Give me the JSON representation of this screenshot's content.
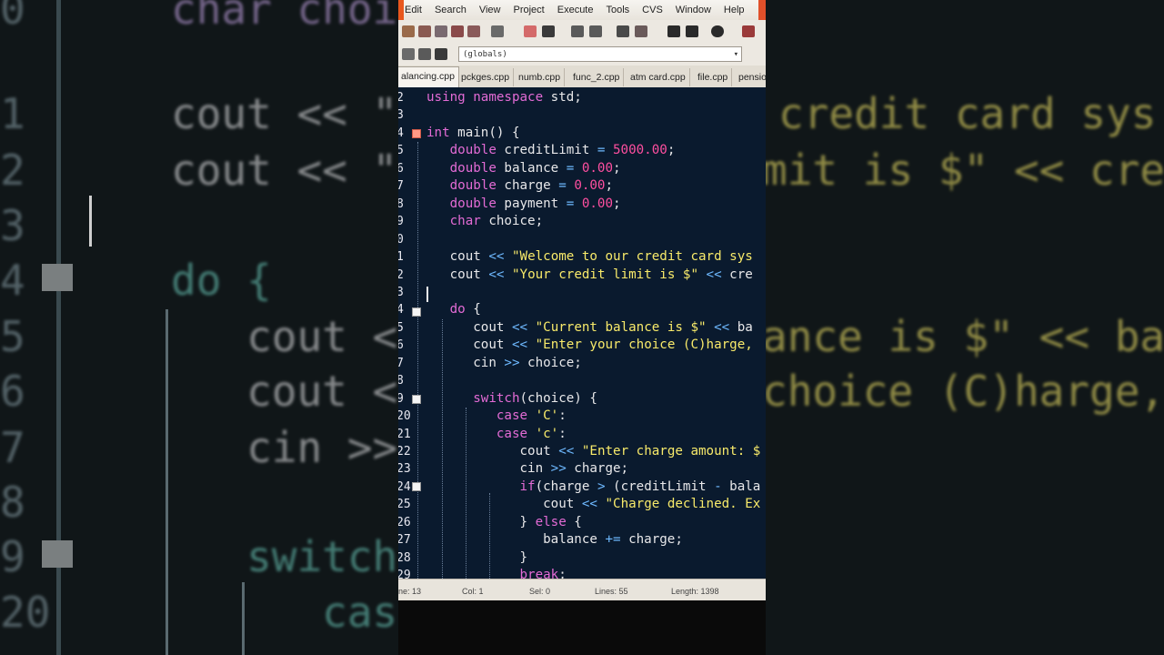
{
  "menu": [
    "Edit",
    "Search",
    "View",
    "Project",
    "Execute",
    "Tools",
    "CVS",
    "Window",
    "Help"
  ],
  "toolbar": {
    "scope_combo_value": "(globals)"
  },
  "tabs": [
    {
      "label": "alancing.cpp",
      "active": true
    },
    {
      "label": "pckges.cpp",
      "active": false
    },
    {
      "label": "numb.cpp",
      "active": false
    },
    {
      "label": "func_2.cpp",
      "active": false
    },
    {
      "label": "atm card.cpp",
      "active": false
    },
    {
      "label": "file.cpp",
      "active": false
    },
    {
      "label": "pensio",
      "active": false
    }
  ],
  "editor": {
    "lines": [
      {
        "n": "2",
        "text": "using namespace std;"
      },
      {
        "n": "3",
        "text": ""
      },
      {
        "n": "4",
        "text": "int main() {"
      },
      {
        "n": "5",
        "text": "   double creditLimit = 5000.00;"
      },
      {
        "n": "6",
        "text": "   double balance = 0.00;"
      },
      {
        "n": "7",
        "text": "   double charge = 0.00;"
      },
      {
        "n": "8",
        "text": "   double payment = 0.00;"
      },
      {
        "n": "9",
        "text": "   char choice;"
      },
      {
        "n": "0",
        "text": ""
      },
      {
        "n": "1",
        "text": "   cout << \"Welcome to our credit card sys"
      },
      {
        "n": "2",
        "text": "   cout << \"Your credit limit is $\" << cre"
      },
      {
        "n": "3",
        "text": ""
      },
      {
        "n": "4",
        "text": "   do {"
      },
      {
        "n": "5",
        "text": "      cout << \"Current balance is $\" << ba"
      },
      {
        "n": "6",
        "text": "      cout << \"Enter your choice (C)harge,"
      },
      {
        "n": "7",
        "text": "      cin >> choice;"
      },
      {
        "n": "8",
        "text": ""
      },
      {
        "n": "9",
        "text": "      switch(choice) {"
      },
      {
        "n": "20",
        "text": "         case 'C':"
      },
      {
        "n": "21",
        "text": "         case 'c':"
      },
      {
        "n": "22",
        "text": "            cout << \"Enter charge amount: $"
      },
      {
        "n": "23",
        "text": "            cin >> charge;"
      },
      {
        "n": "24",
        "text": "            if(charge > (creditLimit - bala"
      },
      {
        "n": "25",
        "text": "               cout << \"Charge declined. Ex"
      },
      {
        "n": "26",
        "text": "            } else {"
      },
      {
        "n": "27",
        "text": "               balance += charge;"
      },
      {
        "n": "28",
        "text": "            }"
      },
      {
        "n": "29",
        "text": "            break;"
      }
    ]
  },
  "status": {
    "line": "ne:   13",
    "col": "Col:   1",
    "sel": "Sel:   0",
    "lines": "Lines:   55",
    "length": "Length:  1398"
  },
  "background_zoom": {
    "left_gutter": [
      "0",
      "1",
      "2",
      "3",
      "4",
      "5",
      "6",
      "7",
      "8",
      "9",
      "20"
    ],
    "left_code": [
      "char choi",
      "",
      "cout << \"",
      "cout << \"",
      "",
      "do {",
      "   cout <",
      "   cout <",
      "   cin >>",
      "",
      "   switch",
      "      cas"
    ],
    "right_code": [
      "",
      "",
      "credit card sys",
      "mit is $\" << cre",
      "",
      "",
      "ance is $\" << bal",
      "choice (C)harge,"
    ]
  },
  "colors": {
    "editor_bg": "#0a1a2e",
    "keyword": "#e36bd5",
    "string": "#f8ea6a",
    "number": "#ff4fa0"
  }
}
